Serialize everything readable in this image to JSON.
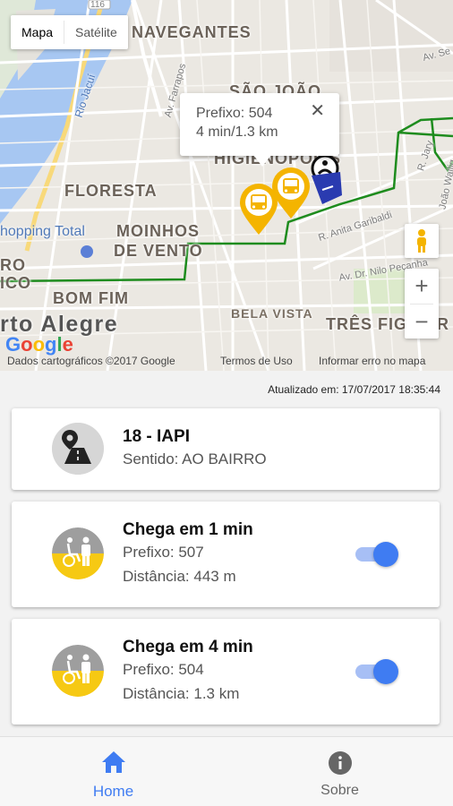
{
  "map": {
    "type_toggle": {
      "map_label": "Mapa",
      "satellite_label": "Satélite"
    },
    "labels": {
      "navegantes": "NAVEGANTES",
      "sao_joao": "SÃO JOÃO",
      "higienopolis": "HIGIENÓPOLIS",
      "floresta": "FLORESTA",
      "moinhos_1": "MOINHOS",
      "moinhos_2": "DE VENTO",
      "bom_fim": "BOM FIM",
      "porto_alegre": "rto Alegre",
      "bela_vista": "BELA VISTA",
      "tres_figueiras": "TRÊS FIGUEIR",
      "ro": "RO",
      "ico": "ICO",
      "shopping_total": "hopping Total",
      "rio_jacui": "Rio Jacuí",
      "av_farrapos": "Av. Farrapos",
      "r_anita": "R. Anita Garibaldi",
      "av_nilo": "Av. Dr. Nilo Peçanha",
      "r_jary": "R. Jary",
      "joao_wallig": "João Wallig",
      "av_se": "Av. Se",
      "route_116": "116"
    },
    "info_window": {
      "prefix": "Prefixo: 504",
      "eta": "4 min/1.3 km",
      "close": "✕"
    },
    "zoom_in": "+",
    "zoom_out": "−",
    "footer": {
      "data": "Dados cartográficos ©2017 Google",
      "terms": "Termos de Uso",
      "report": "Informar erro no mapa"
    },
    "google_logo": "Google",
    "route_color": "#1e8c1e",
    "marker_color": "#f4b400"
  },
  "updated": "Atualizado em: 17/07/2017 18:35:44",
  "line": {
    "title": "18 - IAPI",
    "direction": "Sentido: AO BAIRRO"
  },
  "buses": [
    {
      "title": "Chega em 1 min",
      "prefix": "Prefixo: 507",
      "distance": "Distância: 443 m",
      "tracking_on": true
    },
    {
      "title": "Chega em 4 min",
      "prefix": "Prefixo: 504",
      "distance": "Distância: 1.3 km",
      "tracking_on": true
    }
  ],
  "nav": {
    "home": "Home",
    "about": "Sobre"
  },
  "colors": {
    "accent": "#3f7cf2",
    "accessibility_yellow": "#f6c913",
    "avatar_gray": "#9e9e9e"
  }
}
